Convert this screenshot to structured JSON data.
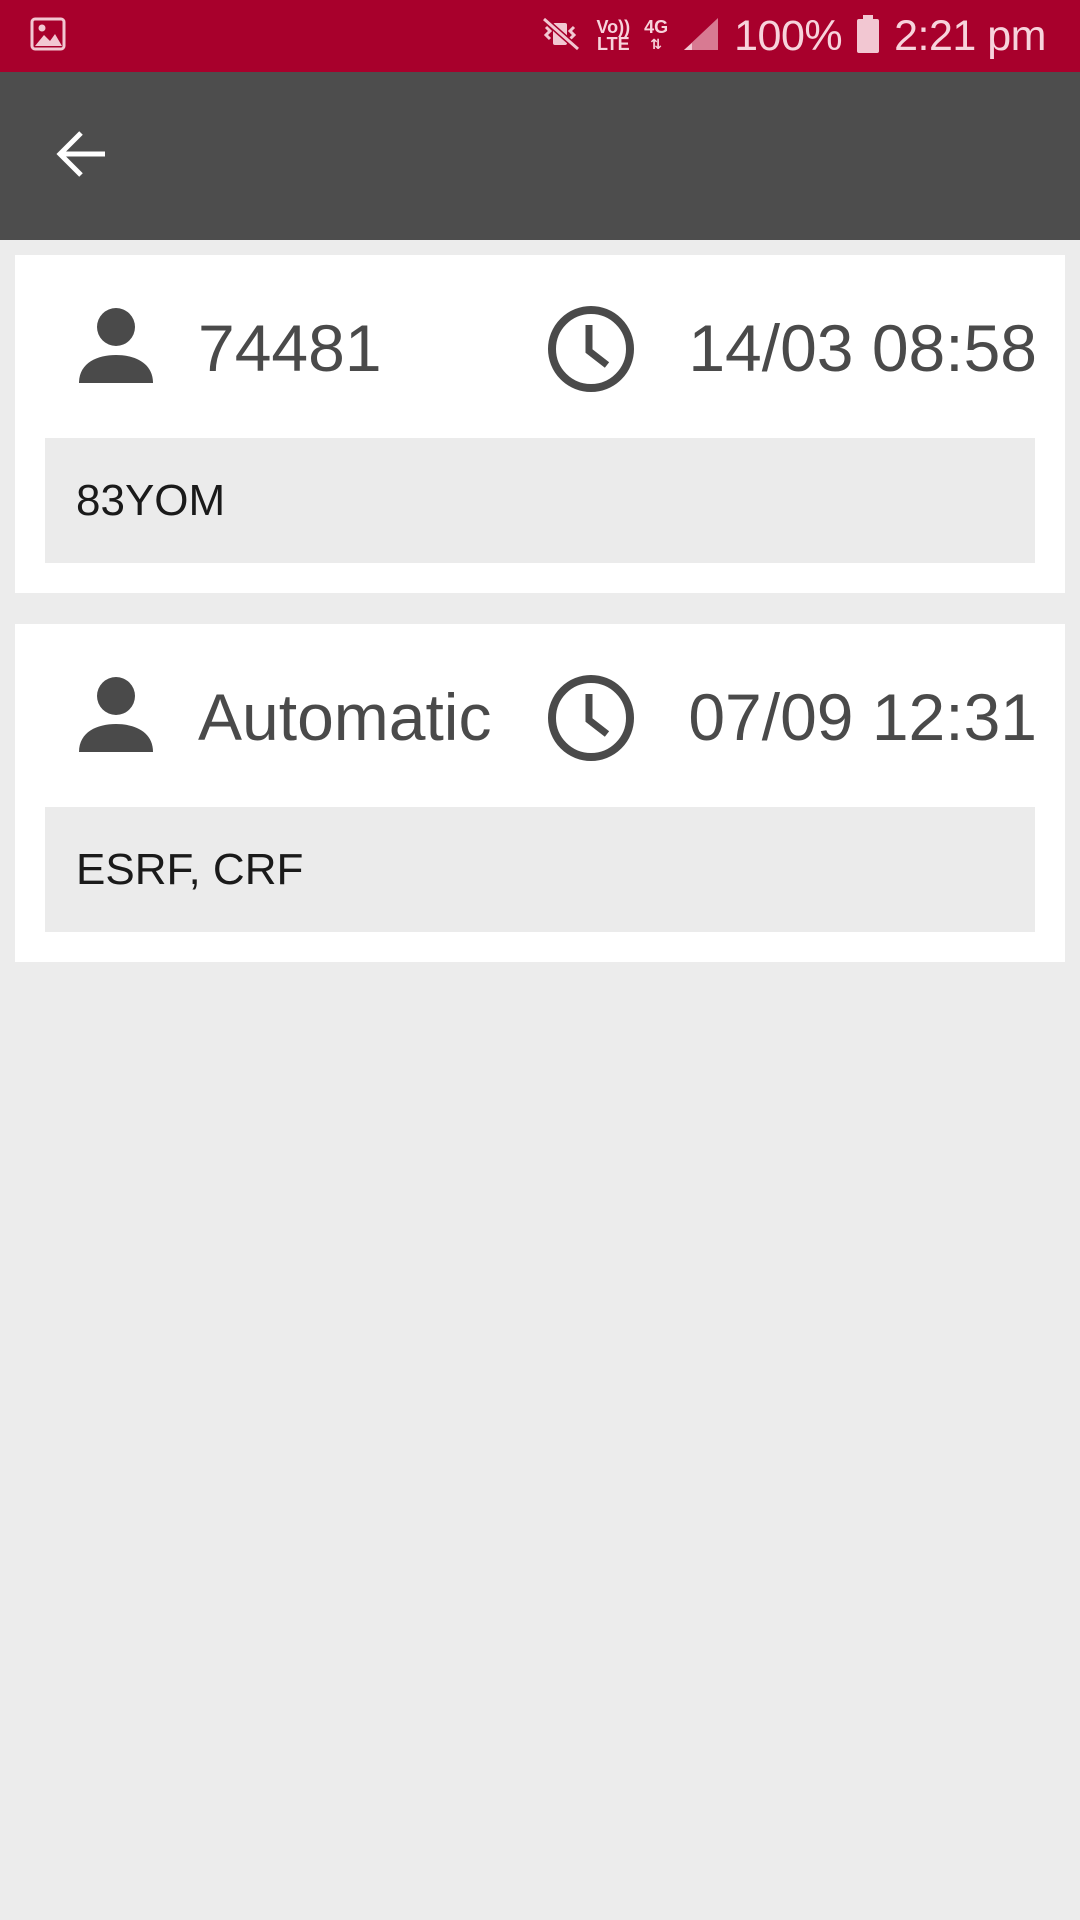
{
  "status_bar": {
    "battery": "100%",
    "time": "2:21 pm",
    "volte_top": "Vo))",
    "volte_bottom": "LTE",
    "network": "4G",
    "icons": [
      "image-icon",
      "muted-vibrate-icon",
      "volte-icon",
      "network-4g-icon",
      "signal-icon",
      "battery-icon"
    ],
    "color": "#a8002c"
  },
  "app_bar": {
    "back_icon": "arrow-left-icon",
    "color": "#4d4d4d"
  },
  "entries": [
    {
      "user": "74481",
      "time": "14/03 08:58",
      "note": "83YOM"
    },
    {
      "user": "Automatic",
      "time": "07/09 12:31",
      "note": "ESRF, CRF"
    }
  ]
}
